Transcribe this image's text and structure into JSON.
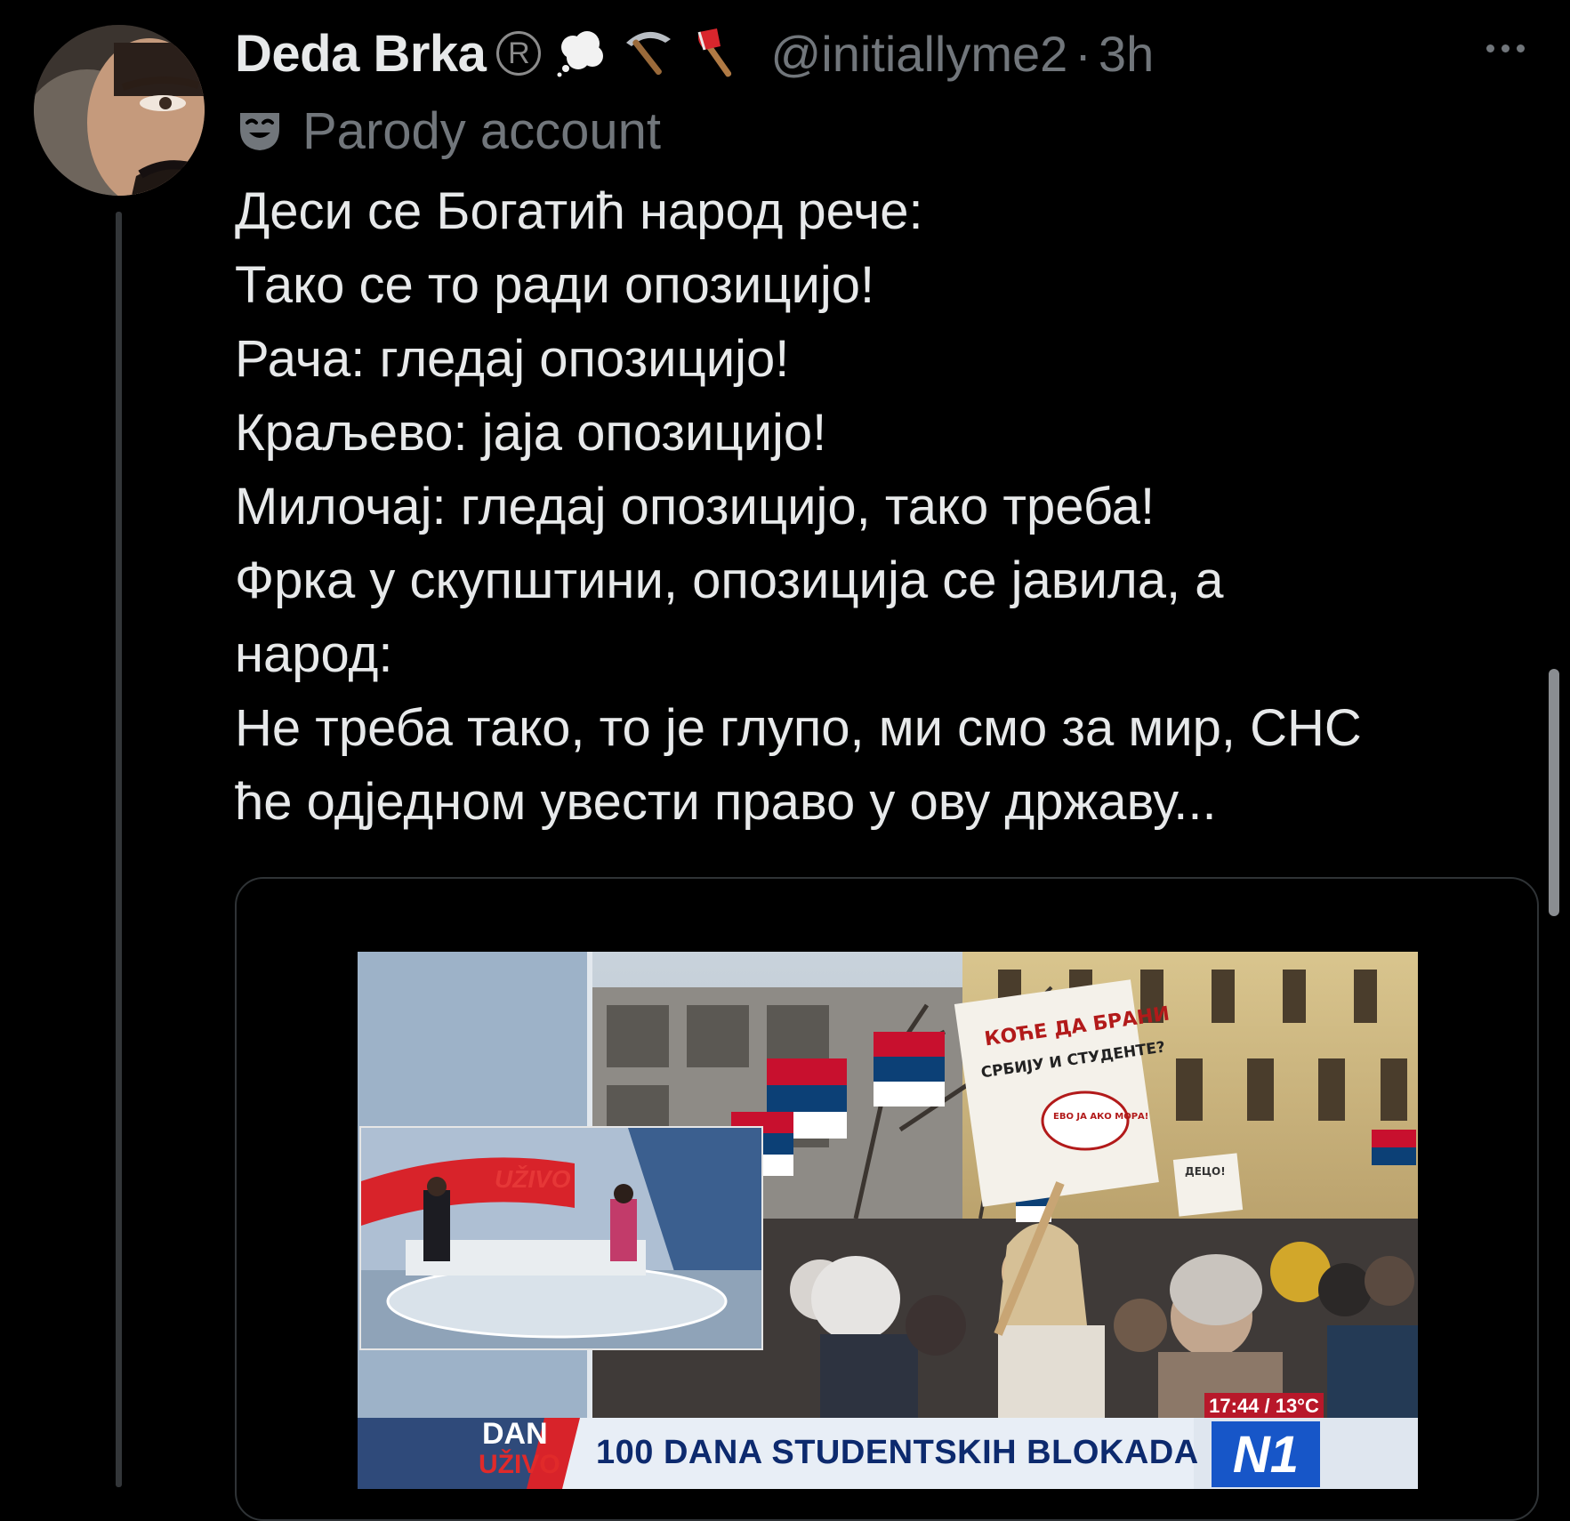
{
  "tweet": {
    "author": {
      "display_name": "Deda Brka",
      "registered_mark": "R",
      "emoji_icons": [
        "thought-bubble-icon",
        "pick-icon",
        "axe-icon"
      ],
      "handle": "@initiallyme2",
      "separator": "·",
      "timestamp": "3h"
    },
    "parody_label": "Parody account",
    "text_lines": [
      "Деси се Богатић народ рече:",
      "Тако се то ради опозицијо!",
      "Рача: гледај опозицијо!",
      "Краљево: јаја опозицијо!",
      "Милочај: гледај опозицијо, тако треба!",
      "Фрка у скупштини, опозиција се јавила, а",
      "народ:",
      "Не треба тако, то је глупо, ми смо за мир, СНС",
      "ће одједном увести право у ову државу..."
    ],
    "media": {
      "ticker_text": "100 DANA STUDENTSKIH BLOKADA",
      "dan_label": "DAN",
      "uzivo_small": "UŽIVO",
      "channel_logo": "N1",
      "time_temp": "17:44 / 13°C",
      "studio_label": "UŽIVO",
      "sign_main_line1": "КОЋЕ ДА БРАНИ",
      "sign_main_line2": "СРБИЈУ И СТУДЕНТЕ?",
      "sign_bubble": "ЕВО ЈА АКО МОРА!",
      "sign_small": "ДЕЦО!"
    }
  },
  "colors": {
    "background": "#000000",
    "text_primary": "#e7e9ea",
    "text_secondary": "#71767b",
    "border": "#2f3336",
    "n1_blue": "#1756c8",
    "flag_red": "#c8102e",
    "flag_blue": "#0c4076"
  }
}
